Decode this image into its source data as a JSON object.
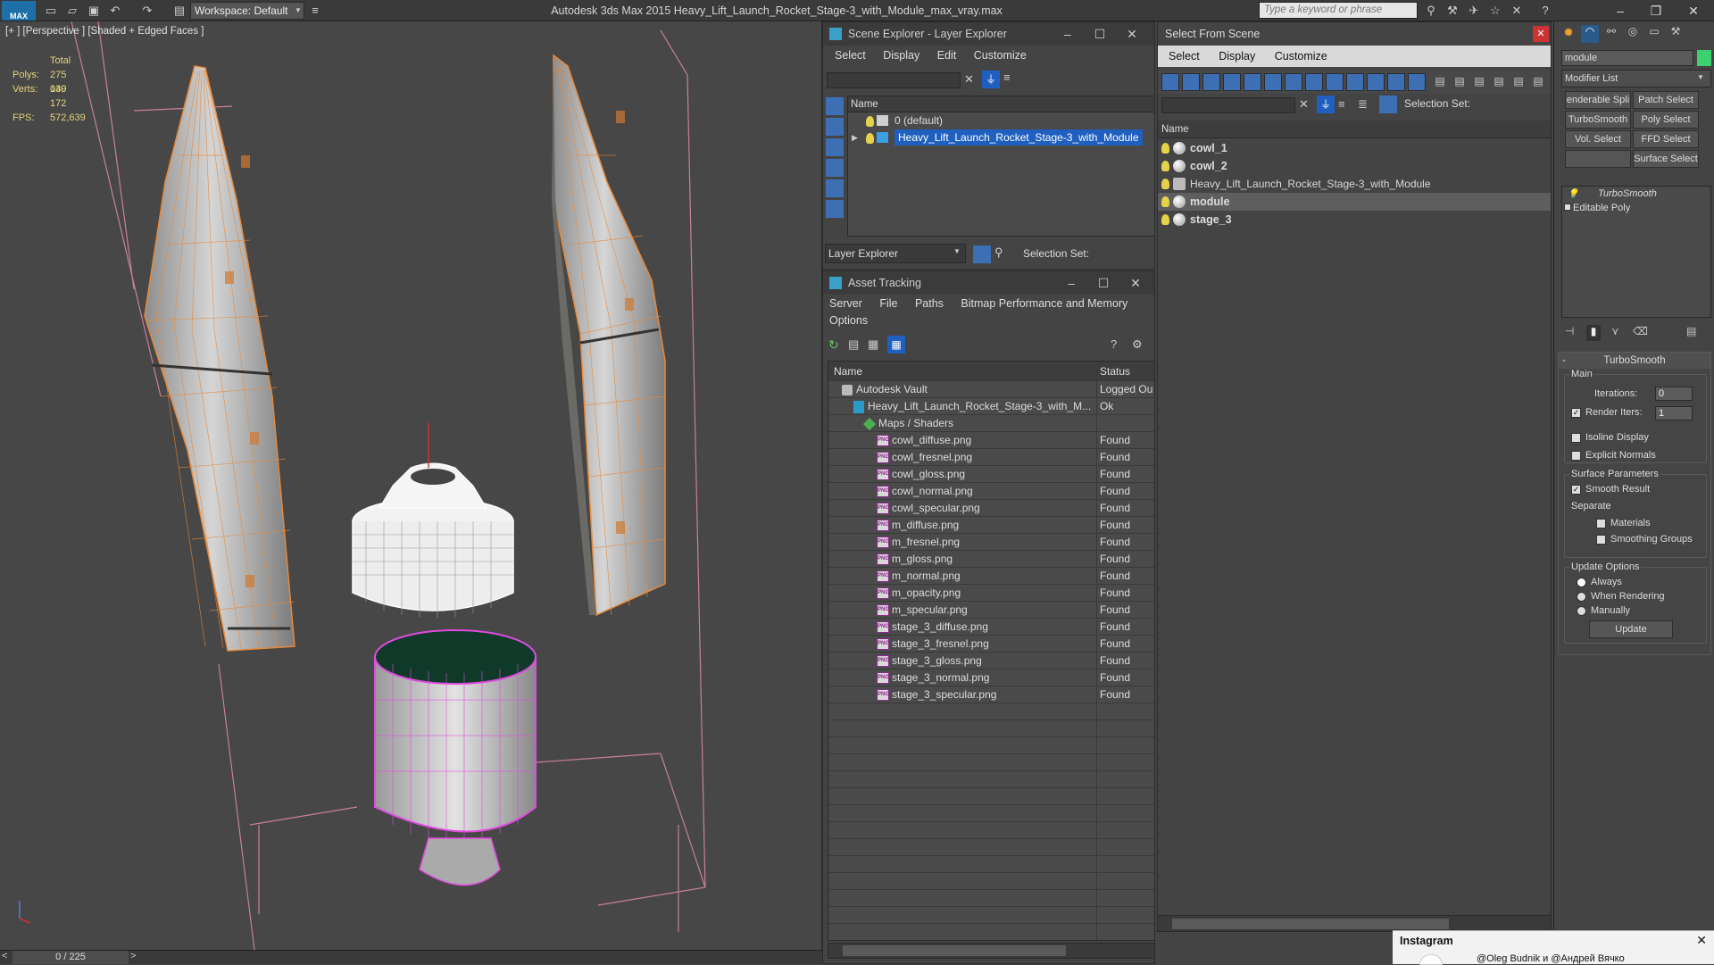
{
  "app": {
    "title": "Autodesk 3ds Max  2015     Heavy_Lift_Launch_Rocket_Stage-3_with_Module_max_vray.max",
    "logo_text": "MAX",
    "workspace": "Workspace: Default",
    "search_placeholder": "Type a keyword or phrase"
  },
  "viewport": {
    "label": "[+ ] [Perspective ] [Shaded + Edged Faces ]",
    "stats": {
      "total_label": "Total",
      "polys_label": "Polys:",
      "polys_value": "275 030",
      "verts_label": "Verts:",
      "verts_value": "149 172",
      "fps_label": "FPS:",
      "fps_value": "572,639"
    },
    "frame_counter": "0 / 225"
  },
  "scene_explorer": {
    "title": "Scene Explorer - Layer Explorer",
    "menu": [
      "Select",
      "Display",
      "Edit",
      "Customize"
    ],
    "column_name": "Name",
    "layers": [
      {
        "name": "0 (default)",
        "selected": false
      },
      {
        "name": "Heavy_Lift_Launch_Rocket_Stage-3_with_Module",
        "selected": true
      }
    ],
    "footer_dropdown": "Layer Explorer",
    "selection_set_label": "Selection Set:"
  },
  "asset_tracking": {
    "title": "Asset Tracking",
    "menu": [
      "Server",
      "File",
      "Paths",
      "Bitmap Performance and Memory"
    ],
    "menu2": "Options",
    "columns": {
      "name": "Name",
      "status": "Status"
    },
    "rows": [
      {
        "name": "Autodesk Vault",
        "status": "Logged Ou",
        "indent": 1,
        "icon": "vault"
      },
      {
        "name": "Heavy_Lift_Launch_Rocket_Stage-3_with_M...",
        "status": "Ok",
        "indent": 2,
        "icon": "max"
      },
      {
        "name": "Maps / Shaders",
        "status": "",
        "indent": 3,
        "icon": "maps"
      },
      {
        "name": "cowl_diffuse.png",
        "status": "Found",
        "indent": 4,
        "icon": "png"
      },
      {
        "name": "cowl_fresnel.png",
        "status": "Found",
        "indent": 4,
        "icon": "png"
      },
      {
        "name": "cowl_gloss.png",
        "status": "Found",
        "indent": 4,
        "icon": "png"
      },
      {
        "name": "cowl_normal.png",
        "status": "Found",
        "indent": 4,
        "icon": "png"
      },
      {
        "name": "cowl_specular.png",
        "status": "Found",
        "indent": 4,
        "icon": "png"
      },
      {
        "name": "m_diffuse.png",
        "status": "Found",
        "indent": 4,
        "icon": "png"
      },
      {
        "name": "m_fresnel.png",
        "status": "Found",
        "indent": 4,
        "icon": "png"
      },
      {
        "name": "m_gloss.png",
        "status": "Found",
        "indent": 4,
        "icon": "png"
      },
      {
        "name": "m_normal.png",
        "status": "Found",
        "indent": 4,
        "icon": "png"
      },
      {
        "name": "m_opacity.png",
        "status": "Found",
        "indent": 4,
        "icon": "png"
      },
      {
        "name": "m_specular.png",
        "status": "Found",
        "indent": 4,
        "icon": "png"
      },
      {
        "name": "stage_3_diffuse.png",
        "status": "Found",
        "indent": 4,
        "icon": "png"
      },
      {
        "name": "stage_3_fresnel.png",
        "status": "Found",
        "indent": 4,
        "icon": "png"
      },
      {
        "name": "stage_3_gloss.png",
        "status": "Found",
        "indent": 4,
        "icon": "png"
      },
      {
        "name": "stage_3_normal.png",
        "status": "Found",
        "indent": 4,
        "icon": "png"
      },
      {
        "name": "stage_3_specular.png",
        "status": "Found",
        "indent": 4,
        "icon": "png"
      }
    ]
  },
  "select_from_scene": {
    "title": "Select From Scene",
    "menu": [
      "Select",
      "Display",
      "Customize"
    ],
    "selection_set_label": "Selection Set:",
    "column_name": "Name",
    "objects": [
      {
        "name": "cowl_1",
        "bold": true,
        "selected": false
      },
      {
        "name": "cowl_2",
        "bold": true,
        "selected": false
      },
      {
        "name": "Heavy_Lift_Launch_Rocket_Stage-3_with_Module",
        "bold": false,
        "selected": false
      },
      {
        "name": "module",
        "bold": true,
        "selected": true
      },
      {
        "name": "stage_3",
        "bold": true,
        "selected": false
      }
    ]
  },
  "command_panel": {
    "object_name": "module",
    "modifier_list": "Modifier List",
    "buttons": [
      "enderable Spli",
      "Patch Select",
      "TurboSmooth",
      "Poly Select",
      "Vol. Select",
      "FFD Select",
      "",
      "Surface Select"
    ],
    "stack": [
      {
        "name": "TurboSmooth",
        "italic": true
      },
      {
        "name": "Editable Poly",
        "italic": false
      }
    ],
    "rollout_title": "TurboSmooth",
    "main_label": "Main",
    "iterations_label": "Iterations:",
    "iterations_value": "0",
    "render_iters_label": "Render Iters:",
    "render_iters_value": "1",
    "isoline_label": "Isoline Display",
    "explicit_normals_label": "Explicit Normals",
    "surface_params_label": "Surface Parameters",
    "smooth_result_label": "Smooth Result",
    "separate_label": "Separate",
    "materials_label": "Materials",
    "smoothing_groups_label": "Smoothing Groups",
    "update_options_label": "Update Options",
    "always_label": "Always",
    "when_rendering_label": "When Rendering",
    "manually_label": "Manually",
    "update_button": "Update"
  },
  "instagram": {
    "title": "Instagram",
    "text": "@Oleg Budnik и @Андрей Вячко"
  },
  "colors": {
    "accent_blue": "#1f5fbf",
    "wire_orange": "#e8893a",
    "wire_magenta": "#e04ae0",
    "stat_yellow": "#e6d27a"
  }
}
